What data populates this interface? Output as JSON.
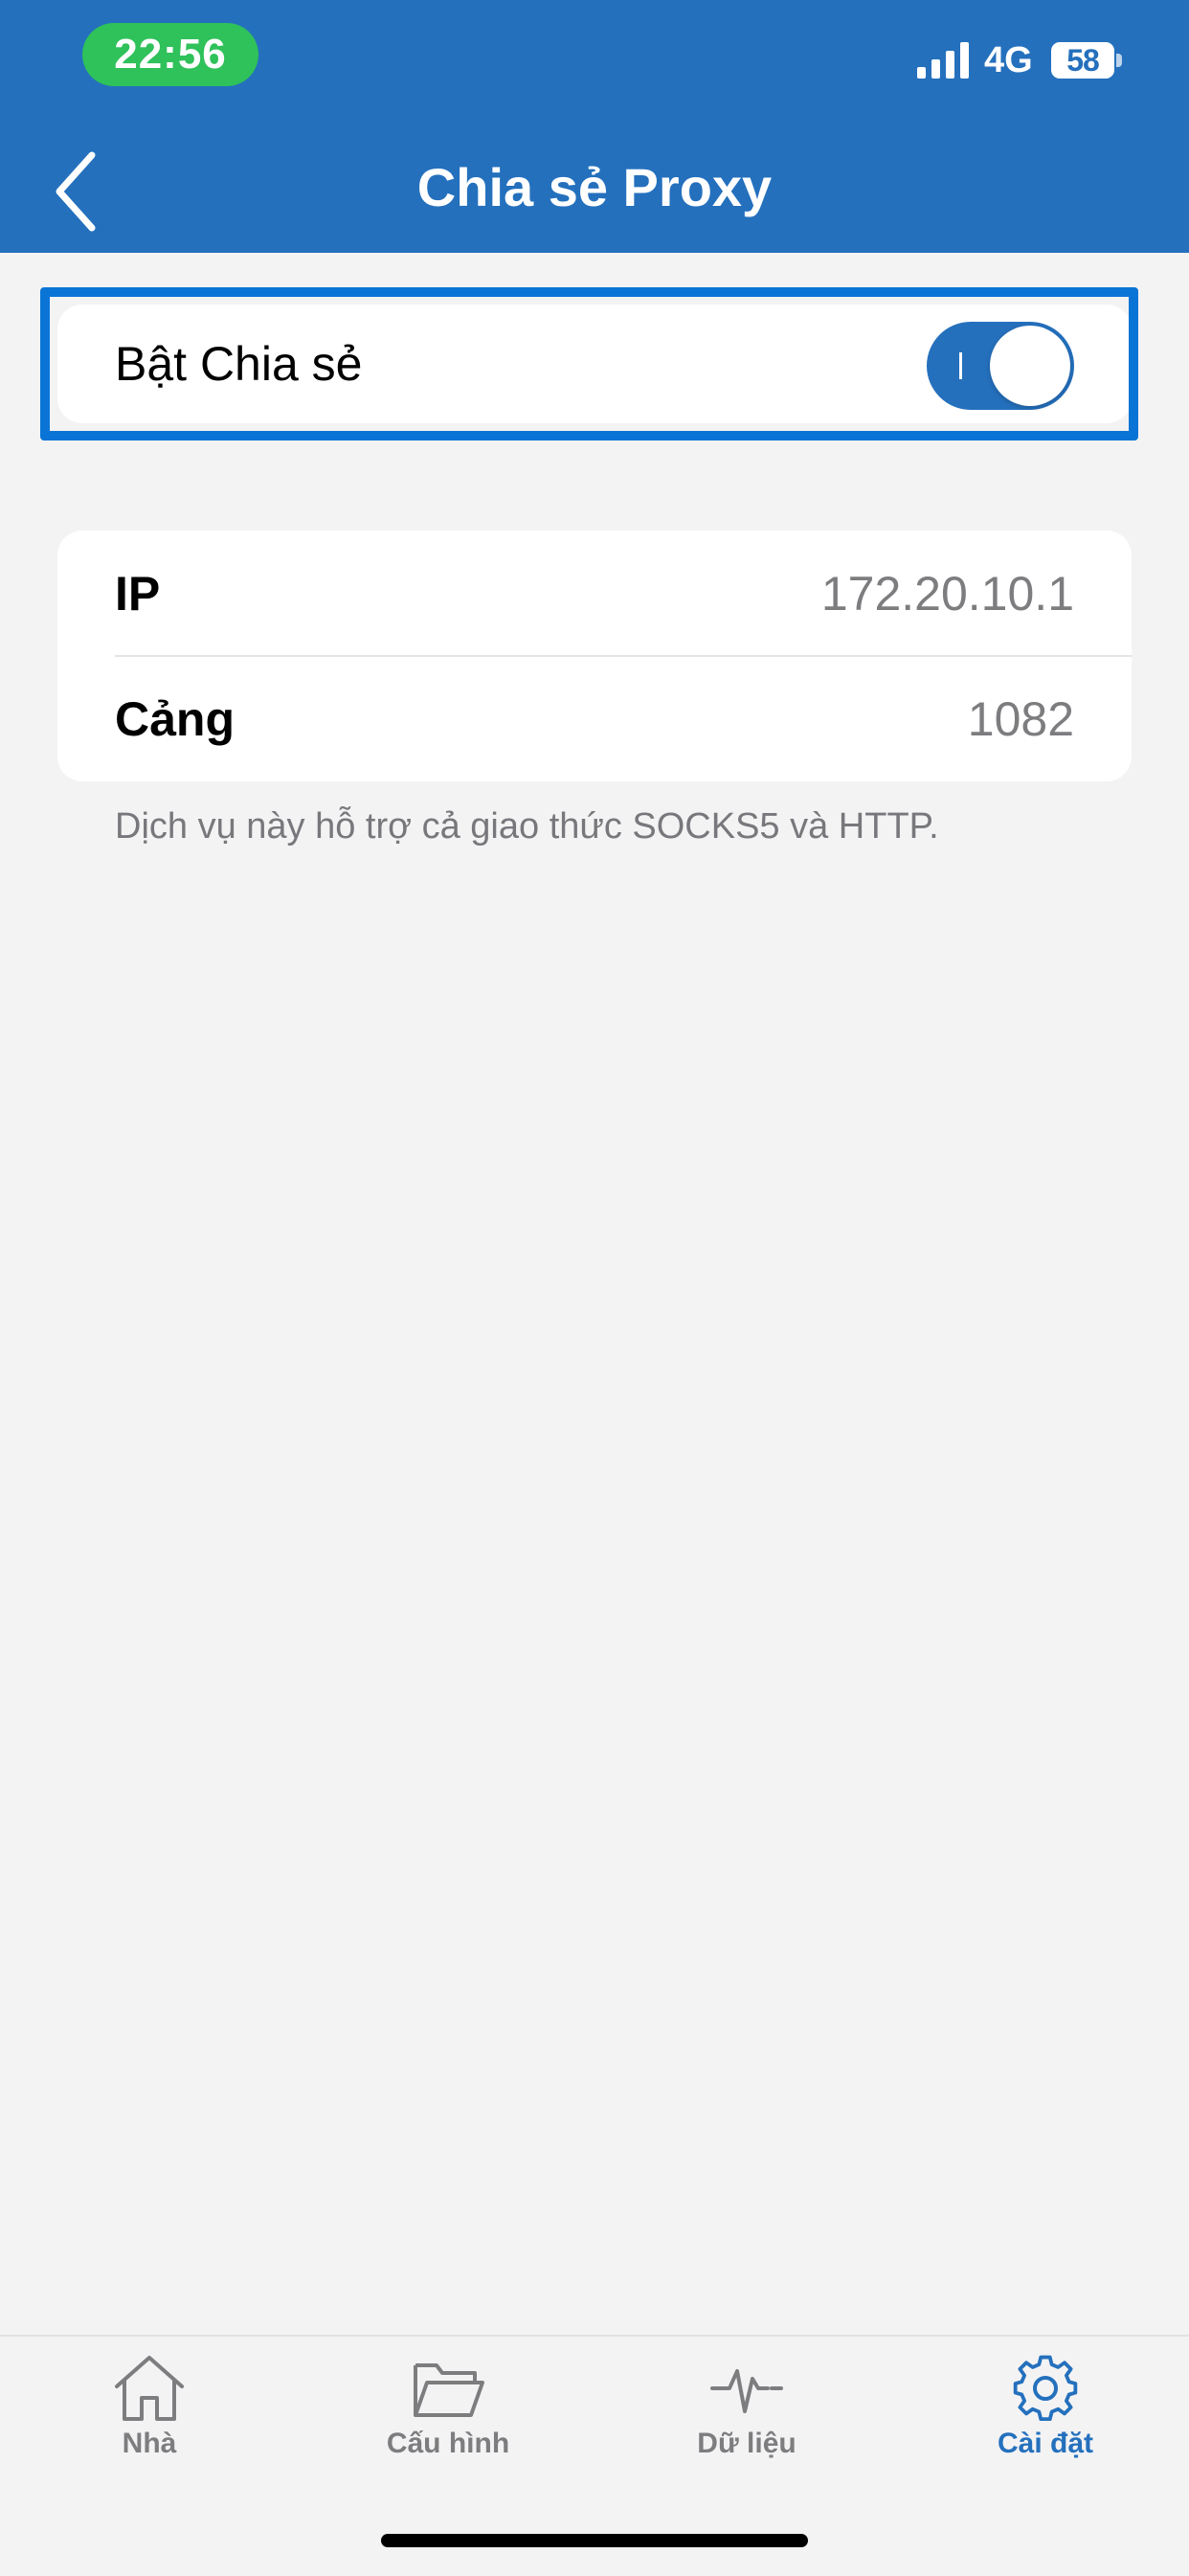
{
  "status_bar": {
    "time": "22:56",
    "network": "4G",
    "battery": "58"
  },
  "header": {
    "title": "Chia sẻ Proxy"
  },
  "sharing": {
    "label": "Bật Chia sẻ",
    "enabled": true
  },
  "info": {
    "rows": [
      {
        "key": "IP",
        "value": "172.20.10.1"
      },
      {
        "key": "Cảng",
        "value": "1082"
      }
    ],
    "footnote": "Dịch vụ này hỗ trợ cả giao thức SOCKS5 và HTTP."
  },
  "tabbar": {
    "items": [
      {
        "label": "Nhà",
        "icon": "home-icon"
      },
      {
        "label": "Cấu hình",
        "icon": "folder-icon"
      },
      {
        "label": "Dữ liệu",
        "icon": "pulse-icon"
      },
      {
        "label": "Cài đặt",
        "icon": "gear-icon",
        "active": true
      }
    ]
  },
  "colors": {
    "accent": "#2470bd",
    "time_pill": "#2fc15a",
    "highlight_frame": "#0a74d6"
  }
}
